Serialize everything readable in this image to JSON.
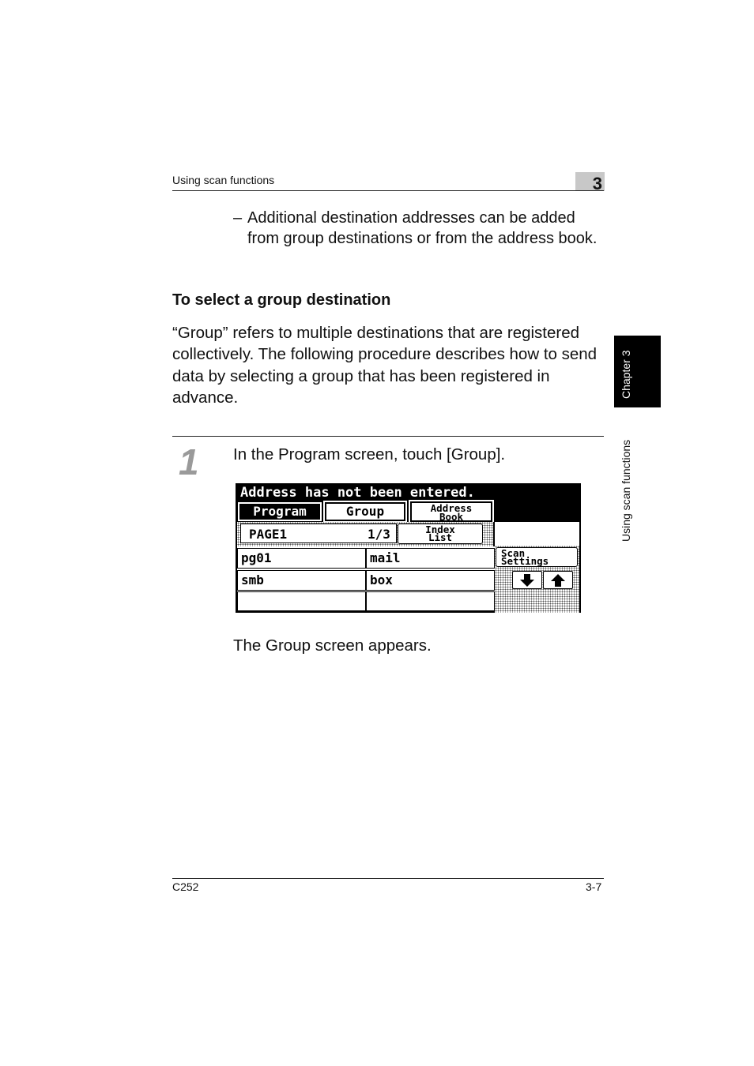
{
  "header": {
    "section_title": "Using scan functions",
    "chapter_number": "3"
  },
  "side_tab": {
    "chapter_label": "Chapter 3",
    "section_label": "Using scan functions"
  },
  "bullet": {
    "dash": "–",
    "text": "Additional destination addresses can be added from group destinations or from the address book."
  },
  "section_heading": "To select a group destination",
  "intro_paragraph": "“Group” refers to multiple destinations that are registered collectively. The following procedure describes how to send data by selecting a group that has been registered in advance.",
  "step": {
    "number": "1",
    "instruction": "In the Program screen, touch [Group].",
    "result": "The Group screen appears."
  },
  "screen": {
    "message": "Address has not been entered.",
    "tabs": {
      "program": "Program",
      "group": "Group",
      "address_book_line1": "Address",
      "address_book_line2": "Book"
    },
    "page_label": "PAGE1",
    "page_counter": "1/3",
    "index_list_line1": "Index",
    "index_list_line2": "List",
    "scan_settings_line1": "Scan",
    "scan_settings_line2": "Settings",
    "entries": [
      [
        "pg01",
        "mail"
      ],
      [
        "smb",
        "box"
      ],
      [
        "",
        ""
      ]
    ],
    "icons": {
      "down": "arrow-down-icon",
      "up": "arrow-up-icon"
    }
  },
  "footer": {
    "model": "C252",
    "page": "3-7"
  }
}
